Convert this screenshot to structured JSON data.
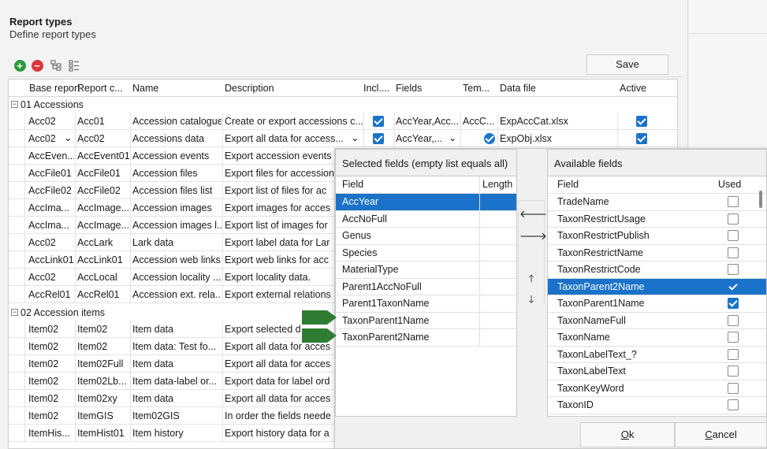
{
  "header": {
    "title": "Report types",
    "subtitle": "Define report types"
  },
  "toolbar": {
    "save_label": "Save"
  },
  "grid": {
    "columns": [
      "Base report",
      "Report c...",
      "Name",
      "Description",
      "Incl....",
      "Fields",
      "Tem...",
      "Data file",
      "Active"
    ],
    "groups": [
      "01 Accessions",
      "02 Accession items"
    ],
    "rows_g1": [
      {
        "base": "Acc02",
        "code": "Acc01",
        "name": "Accession catalogue",
        "desc": "Create or export accessions c...",
        "fields": "AccYear,Acc...",
        "tem": "AccC...",
        "file": "ExpAccCat.xlsx"
      },
      {
        "base": "Acc02",
        "code": "Acc02",
        "name": "Accessions data",
        "desc": "Export all data for access...",
        "fields": "AccYear,...",
        "tem": "",
        "file": "ExpObj.xlsx"
      },
      {
        "base": "AccEven...",
        "code": "AccEvent01",
        "name": "Accession events",
        "desc": "Export accession events"
      },
      {
        "base": "AccFile01",
        "code": "AccFile01",
        "name": "Accession files",
        "desc": "Export files for accession"
      },
      {
        "base": "AccFile02",
        "code": "AccFile02",
        "name": "Accession files list",
        "desc": "Export list of files for ac"
      },
      {
        "base": "AccIma...",
        "code": "AccImage...",
        "name": "Accession images",
        "desc": "Export images for acces"
      },
      {
        "base": "AccIma...",
        "code": "AccImage...",
        "name": "Accession images l...",
        "desc": "Export list of images for"
      },
      {
        "base": "Acc02",
        "code": "AccLark",
        "name": "Lark data",
        "desc": "Export label data for Lar"
      },
      {
        "base": "AccLink01",
        "code": "AccLink01",
        "name": "Accession web links",
        "desc": "Export web links for acc"
      },
      {
        "base": "Acc02",
        "code": "AccLocal",
        "name": "Accession locality ...",
        "desc": "Export locality data."
      },
      {
        "base": "AccRel01",
        "code": "AccRel01",
        "name": "Accession ext. rela...",
        "desc": "Export external relations"
      }
    ],
    "rows_g2": [
      {
        "base": "Item02",
        "code": "Item02",
        "name": "Item data",
        "desc": "Export selected d"
      },
      {
        "base": "Item02",
        "code": "Item02",
        "name": "Item data: Test fo...",
        "desc": "Export all data for acces"
      },
      {
        "base": "Item02",
        "code": "Item02Full",
        "name": "Item data",
        "desc": "Export all data for acces"
      },
      {
        "base": "Item02",
        "code": "Item02Lb...",
        "name": "Item data-label or...",
        "desc": "Export data for label ord"
      },
      {
        "base": "Item02",
        "code": "Item02xy",
        "name": "Item data",
        "desc": "Export all data for acces"
      },
      {
        "base": "Item02",
        "code": "ItemGIS",
        "name": "Item02GIS",
        "desc": "In order the fields neede"
      },
      {
        "base": "ItemHis...",
        "code": "ItemHist01",
        "name": "Item history",
        "desc": "Export history data for a"
      }
    ]
  },
  "selected_panel": {
    "title": "Selected fields (empty list equals all)",
    "col_field": "Field",
    "col_length": "Length",
    "rows": [
      "AccYear",
      "AccNoFull",
      "Genus",
      "Species",
      "MaterialType",
      "Parent1AccNoFull",
      "Parent1TaxonName",
      "TaxonParent1Name",
      "TaxonParent2Name"
    ]
  },
  "available_panel": {
    "title": "Available fields",
    "col_field": "Field",
    "col_used": "Used",
    "rows": [
      {
        "name": "TradeName",
        "used": false
      },
      {
        "name": "TaxonRestrictUsage",
        "used": false
      },
      {
        "name": "TaxonRestrictPublish",
        "used": false
      },
      {
        "name": "TaxonRestrictName",
        "used": false
      },
      {
        "name": "TaxonRestrictCode",
        "used": false
      },
      {
        "name": "TaxonParent2Name",
        "used": true
      },
      {
        "name": "TaxonParent1Name",
        "used": true
      },
      {
        "name": "TaxonNameFull",
        "used": false
      },
      {
        "name": "TaxonName",
        "used": false
      },
      {
        "name": "TaxonLabelText_?",
        "used": false
      },
      {
        "name": "TaxonLabelText",
        "used": false
      },
      {
        "name": "TaxonKeyWord",
        "used": false
      },
      {
        "name": "TaxonID",
        "used": false
      }
    ]
  },
  "dialog": {
    "ok_label": "Ok",
    "ok_u": "O",
    "ok_rest": "k",
    "cancel_label": "Cancel",
    "cancel_u": "C",
    "cancel_rest": "ancel"
  },
  "colors": {
    "accent": "#1a73c8",
    "green_marker": "#2e7d32"
  }
}
